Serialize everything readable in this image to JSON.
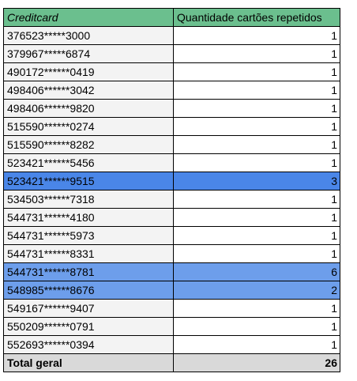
{
  "table": {
    "headers": [
      "Creditcard",
      "Quantidade cartões repetidos"
    ],
    "rows": [
      {
        "card": "376523*****3000",
        "count": "1",
        "highlight": ""
      },
      {
        "card": "379967*****6874",
        "count": "1",
        "highlight": ""
      },
      {
        "card": "490172******0419",
        "count": "1",
        "highlight": ""
      },
      {
        "card": "498406******3042",
        "count": "1",
        "highlight": ""
      },
      {
        "card": "498406******9820",
        "count": "1",
        "highlight": ""
      },
      {
        "card": "515590******0274",
        "count": "1",
        "highlight": ""
      },
      {
        "card": "515590******8282",
        "count": "1",
        "highlight": ""
      },
      {
        "card": "523421******5456",
        "count": "1",
        "highlight": ""
      },
      {
        "card": "523421******9515",
        "count": "3",
        "highlight": "strong"
      },
      {
        "card": "534503******7318",
        "count": "1",
        "highlight": ""
      },
      {
        "card": "544731******4180",
        "count": "1",
        "highlight": ""
      },
      {
        "card": "544731******5973",
        "count": "1",
        "highlight": ""
      },
      {
        "card": "544731******8331",
        "count": "1",
        "highlight": ""
      },
      {
        "card": "544731******8781",
        "count": "6",
        "highlight": "mid"
      },
      {
        "card": "548985******8676",
        "count": "2",
        "highlight": "mid"
      },
      {
        "card": "549167******9407",
        "count": "1",
        "highlight": ""
      },
      {
        "card": "550209******0791",
        "count": "1",
        "highlight": ""
      },
      {
        "card": "552693******0394",
        "count": "1",
        "highlight": ""
      }
    ],
    "total": {
      "label": "Total geral",
      "value": "26"
    }
  },
  "colors": {
    "header_bg": "#6bbf8e",
    "highlight_strong": "#4a86e8",
    "highlight_mid": "#6d9eeb",
    "total_bg": "#d9d9d9"
  }
}
